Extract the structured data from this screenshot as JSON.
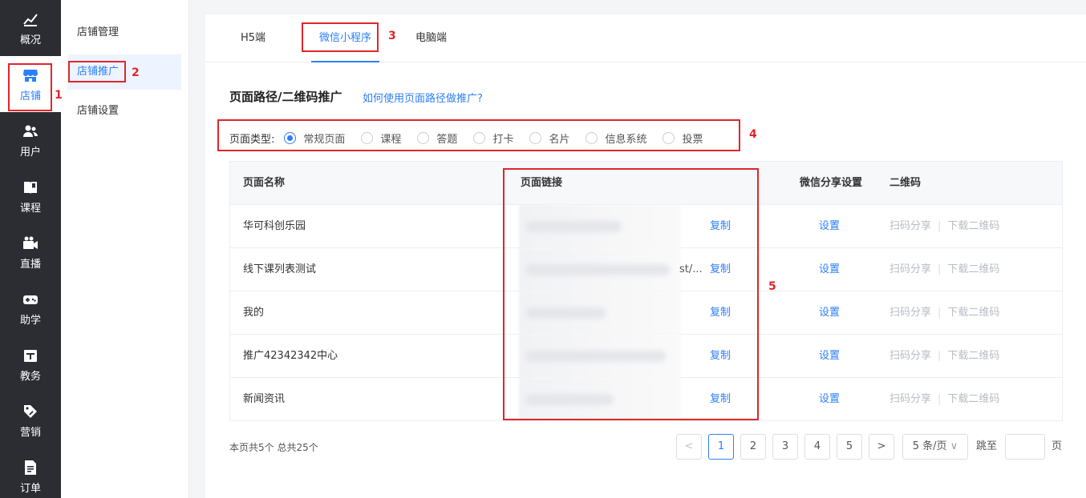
{
  "rail": {
    "items": [
      {
        "label": "概况",
        "icon": "chart-icon"
      },
      {
        "label": "店铺",
        "icon": "store-icon"
      },
      {
        "label": "用户",
        "icon": "users-icon"
      },
      {
        "label": "课程",
        "icon": "book-icon"
      },
      {
        "label": "直播",
        "icon": "video-camera-icon"
      },
      {
        "label": "助学",
        "icon": "gamepad-icon"
      },
      {
        "label": "教务",
        "icon": "calendar-icon"
      },
      {
        "label": "营销",
        "icon": "tag-icon"
      },
      {
        "label": "订单",
        "icon": "document-icon"
      }
    ],
    "active_index": 1
  },
  "submenu": {
    "items": [
      "店铺管理",
      "店铺推广",
      "店铺设置"
    ],
    "active_index": 1
  },
  "tabs": [
    "H5端",
    "微信小程序",
    "电脑端"
  ],
  "active_tab": 1,
  "section": {
    "title": "页面路径/二维码推广",
    "help_link": "如何使用页面路径做推广?"
  },
  "filter": {
    "label": "页面类型:",
    "options": [
      "常规页面",
      "课程",
      "答题",
      "打卡",
      "名片",
      "信息系统",
      "投票"
    ],
    "selected_index": 0
  },
  "table": {
    "headers": [
      "页面名称",
      "页面链接",
      "微信分享设置",
      "二维码"
    ],
    "rows": [
      {
        "name": "华可科创乐园",
        "link_tail": "",
        "copy": "复制",
        "share": "设置",
        "scan": "扫码分享",
        "download": "下载二维码"
      },
      {
        "name": "线下课列表测试",
        "link_tail": "st/...",
        "copy": "复制",
        "share": "设置",
        "scan": "扫码分享",
        "download": "下载二维码"
      },
      {
        "name": "我的",
        "link_tail": "",
        "copy": "复制",
        "share": "设置",
        "scan": "扫码分享",
        "download": "下载二维码"
      },
      {
        "name": "推广42342342中心",
        "link_tail": "",
        "copy": "复制",
        "share": "设置",
        "scan": "扫码分享",
        "download": "下载二维码"
      },
      {
        "name": "新闻资讯",
        "link_tail": "",
        "copy": "复制",
        "share": "设置",
        "scan": "扫码分享",
        "download": "下载二维码"
      }
    ]
  },
  "footer": {
    "summary": "本页共5个 总共25个",
    "prev": "<",
    "pages": [
      "1",
      "2",
      "3",
      "4",
      "5"
    ],
    "current_page": "1",
    "next": ">",
    "page_size": "5 条/页",
    "jump_label": "跳至",
    "jump_suffix": "页"
  },
  "annotations": [
    "1",
    "2",
    "3",
    "4",
    "5"
  ],
  "colors": {
    "accent": "#2d7ff9",
    "annotation": "#e0262b",
    "rail_bg": "#2b2d33"
  }
}
